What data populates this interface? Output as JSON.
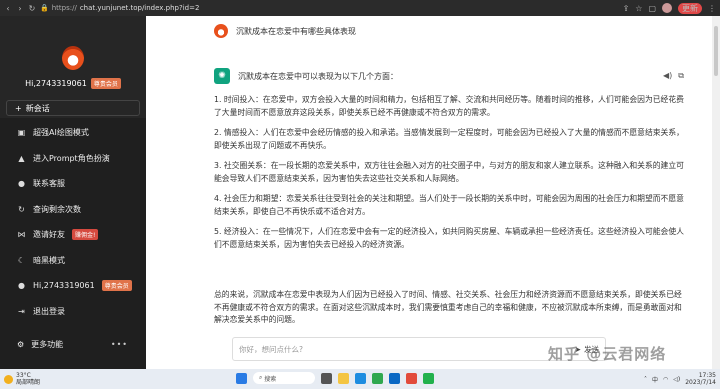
{
  "browser": {
    "url_dim": "https://",
    "url": "chat.yunjunet.top/index.php?id=2",
    "update_badge": "更新"
  },
  "sidebar": {
    "username": "Hi,2743319061",
    "vip": "尊贵会员",
    "new_chat": "新会话",
    "items": [
      {
        "icon": "image-icon",
        "glyph": "▣",
        "label": "超强AI绘图模式"
      },
      {
        "icon": "graduation-icon",
        "glyph": "▲",
        "label": "进入Prompt角色扮演"
      },
      {
        "icon": "wechat-icon",
        "glyph": "●",
        "label": "联系客服"
      },
      {
        "icon": "refresh-icon",
        "glyph": "↻",
        "label": "查询剩余次数"
      },
      {
        "icon": "share-icon",
        "glyph": "⋈",
        "label": "邀请好友",
        "badge": "赚佣金!"
      },
      {
        "icon": "moon-icon",
        "glyph": "☾",
        "label": "暗黑模式"
      },
      {
        "icon": "user-icon",
        "glyph": "●",
        "label": "Hi,2743319061",
        "badge": "尊贵会员"
      },
      {
        "icon": "logout-icon",
        "glyph": "⇥",
        "label": "退出登录"
      }
    ],
    "more": "更多功能",
    "more_dots": "•••"
  },
  "chat": {
    "question": "沉默成本在恋爱中有哪些具体表现",
    "intro": "沉默成本在恋爱中可以表现为以下几个方面：",
    "points": [
      "1. 时间投入：在恋爱中，双方会投入大量的时间和精力，包括相互了解、交流和共同经历等。随着时间的推移，人们可能会因为已经花费了大量时间而不愿意放弃这段关系，即使关系已经不再健康或不符合双方的需求。",
      "2. 情感投入：人们在恋爱中会经历情感的投入和承诺。当感情发展到一定程度时，可能会因为已经投入了大量的情感而不愿意结束关系，即使关系出现了问题或不再快乐。",
      "3. 社交圈关系：在一段长期的恋爱关系中，双方往往会融入对方的社交圈子中，与对方的朋友和家人建立联系。这种融入和关系的建立可能会导致人们不愿意结束关系，因为害怕失去这些社交关系和人际网络。",
      "4. 社会压力和期望：恋爱关系往往受到社会的关注和期望。当人们处于一段长期的关系中时，可能会因为周围的社会压力和期望而不愿意结束关系，即使自己不再快乐或不适合对方。",
      "5. 经济投入：在一些情况下，人们在恋爱中会有一定的经济投入，如共同购买房屋、车辆或承担一些经济责任。这些经济投入可能会使人们不愿意结束关系，因为害怕失去已经投入的经济资源。"
    ],
    "summary": "总的来说，沉默成本在恋爱中表现为人们因为已经投入了时间、情感、社交关系、社会压力和经济资源而不愿意结束关系，即使关系已经不再健康或不符合双方的需求。在面对这些沉默成本时，我们需要慎重考虑自己的幸福和健康，不应被沉默成本所束缚，而是勇敢面对和解决恋爱关系中的问题。",
    "input_placeholder": "你好，想问点什么?",
    "send": "发送"
  },
  "watermark": "知乎 @云君网络",
  "taskbar": {
    "temp": "33°C",
    "weather": "局部晴朗",
    "search": "搜索",
    "time": "17:35",
    "date": "2023/7/14",
    "lang": "中"
  }
}
